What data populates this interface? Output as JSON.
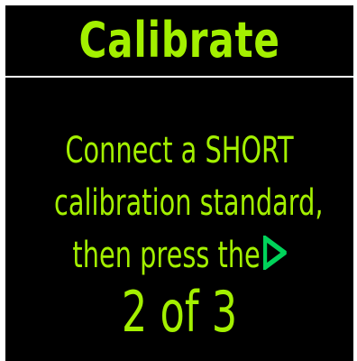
{
  "colors": {
    "background": "#000000",
    "text": "#a3f000",
    "divider": "#ffffff",
    "play_icon": "#00d35a"
  },
  "header": {
    "title": "Calibrate"
  },
  "message": {
    "line1": "Connect a SHORT",
    "line2": "calibration standard,",
    "line3": "then press the"
  },
  "icons": {
    "next": "play-triangle-icon"
  },
  "progress": {
    "text": "2 of 3"
  }
}
